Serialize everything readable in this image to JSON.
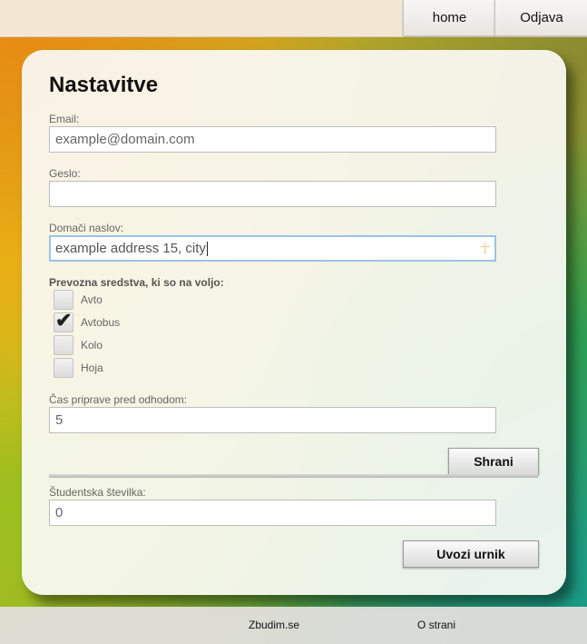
{
  "nav": {
    "home_label": "home",
    "logout_label": "Odjava"
  },
  "page": {
    "title": "Nastavitve"
  },
  "form": {
    "email": {
      "label": "Email:",
      "value": "example@domain.com"
    },
    "password": {
      "label": "Geslo:",
      "value": ""
    },
    "address": {
      "label": "Domači naslov:",
      "value": "example address 15, city"
    },
    "transport": {
      "label": "Prevozna sredstva, ki so na voljo:",
      "options": [
        {
          "label": "Avto",
          "checked": false
        },
        {
          "label": "Avtobus",
          "checked": true
        },
        {
          "label": "Kolo",
          "checked": false
        },
        {
          "label": "Hoja",
          "checked": false
        }
      ]
    },
    "prep_time": {
      "label": "Čas priprave pred odhodom:",
      "value": "5"
    },
    "save_label": "Shrani",
    "student_id": {
      "label": "Študentska številka:",
      "value": "0"
    },
    "import_label": "Uvozi urnik"
  },
  "footer": {
    "link1": "Zbudim.se",
    "link2": "O strani"
  }
}
